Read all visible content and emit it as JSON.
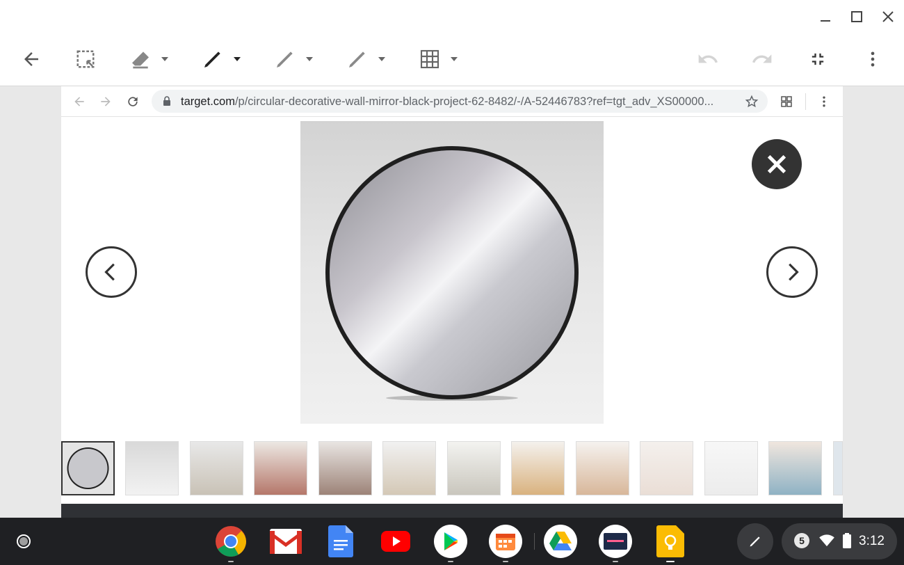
{
  "window": {
    "controls": [
      {
        "name": "minimize-icon"
      },
      {
        "name": "maximize-icon"
      },
      {
        "name": "close-icon"
      }
    ]
  },
  "toolbar": {
    "tools": [
      {
        "name": "back-arrow-icon"
      },
      {
        "name": "select-region-icon"
      },
      {
        "name": "eraser-icon"
      },
      {
        "name": "pen-icon"
      },
      {
        "name": "marker-icon"
      },
      {
        "name": "highlighter-icon"
      },
      {
        "name": "grid-icon"
      },
      {
        "name": "undo-icon"
      },
      {
        "name": "redo-icon"
      },
      {
        "name": "exit-fullscreen-icon"
      },
      {
        "name": "more-vert-icon"
      }
    ]
  },
  "browser": {
    "url_host": "target.com",
    "url_path": "/p/circular-decorative-wall-mirror-black-project-62-8482/-/A-52446783?ref=tgt_adv_XS00000..."
  },
  "gallery": {
    "thumbnail_count": 13,
    "selected_index": 0
  },
  "shelf": {
    "apps": [
      {
        "name": "chrome-icon"
      },
      {
        "name": "gmail-icon"
      },
      {
        "name": "docs-icon"
      },
      {
        "name": "youtube-icon"
      },
      {
        "name": "play-store-icon"
      },
      {
        "name": "calendar-app-icon"
      },
      {
        "name": "drive-icon"
      },
      {
        "name": "mozaic-icon"
      },
      {
        "name": "keep-icon"
      }
    ],
    "notification_count": "5",
    "time": "3:12"
  }
}
